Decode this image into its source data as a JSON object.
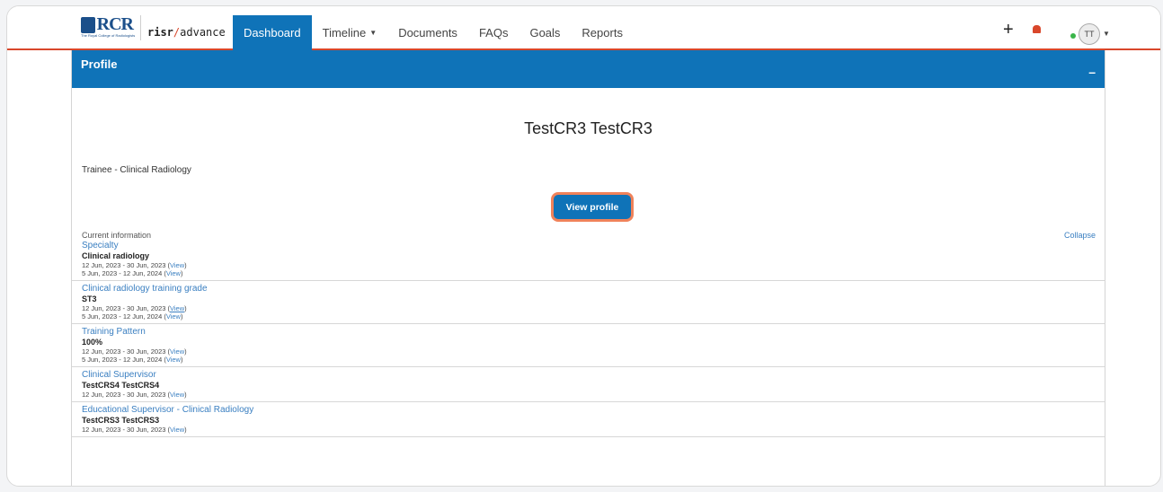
{
  "brand": {
    "logo_text": "RCR",
    "logo_subtext": "The Royal College of Radiologists",
    "product_bold": "risr",
    "product_slash": "/",
    "product_rest": "advance"
  },
  "nav": {
    "items": [
      {
        "label": "Dashboard",
        "active": true
      },
      {
        "label": "Timeline",
        "dropdown": true
      },
      {
        "label": "Documents"
      },
      {
        "label": "FAQs"
      },
      {
        "label": "Goals"
      },
      {
        "label": "Reports"
      }
    ]
  },
  "topbar": {
    "add_icon": "+",
    "bell_icon": "bell-icon",
    "avatar_initials": "TT",
    "status_color": "#3bb54a"
  },
  "profile": {
    "card_title": "Profile",
    "collapse_symbol": "–",
    "full_name": "TestCR3 TestCR3",
    "role": "Trainee - Clinical Radiology",
    "view_button": "View profile",
    "current_info_label": "Current information",
    "collapse_link": "Collapse"
  },
  "sections": [
    {
      "title": "Specialty",
      "value": "Clinical radiology",
      "dates": [
        {
          "range": "12 Jun, 2023 - 30 Jun, 2023",
          "link": "View"
        },
        {
          "range": "5 Jun, 2023 - 12 Jun, 2024",
          "link": "View"
        }
      ]
    },
    {
      "title": "Clinical radiology training grade",
      "value": "ST3",
      "dates": [
        {
          "range": "12 Jun, 2023 - 30 Jun, 2023",
          "link": "View"
        },
        {
          "range": "5 Jun, 2023 - 12 Jun, 2024",
          "link": "View"
        }
      ]
    },
    {
      "title": "Training Pattern",
      "value": "100%",
      "dates": [
        {
          "range": "12 Jun, 2023 - 30 Jun, 2023",
          "link": "View"
        },
        {
          "range": "5 Jun, 2023 - 12 Jun, 2024",
          "link": "View"
        }
      ]
    },
    {
      "title": "Clinical Supervisor",
      "value": "TestCRS4 TestCRS4",
      "dates": [
        {
          "range": "12 Jun, 2023 - 30 Jun, 2023",
          "link": "View"
        }
      ]
    },
    {
      "title": "Educational Supervisor - Clinical Radiology",
      "value": "TestCRS3 TestCRS3",
      "dates": [
        {
          "range": "12 Jun, 2023 - 30 Jun, 2023",
          "link": "View"
        }
      ]
    }
  ],
  "colors": {
    "accent": "#0f73b8",
    "highlight_ring": "#f0825a",
    "topbar_rule": "#d9472b",
    "link": "#3a7fc1"
  }
}
